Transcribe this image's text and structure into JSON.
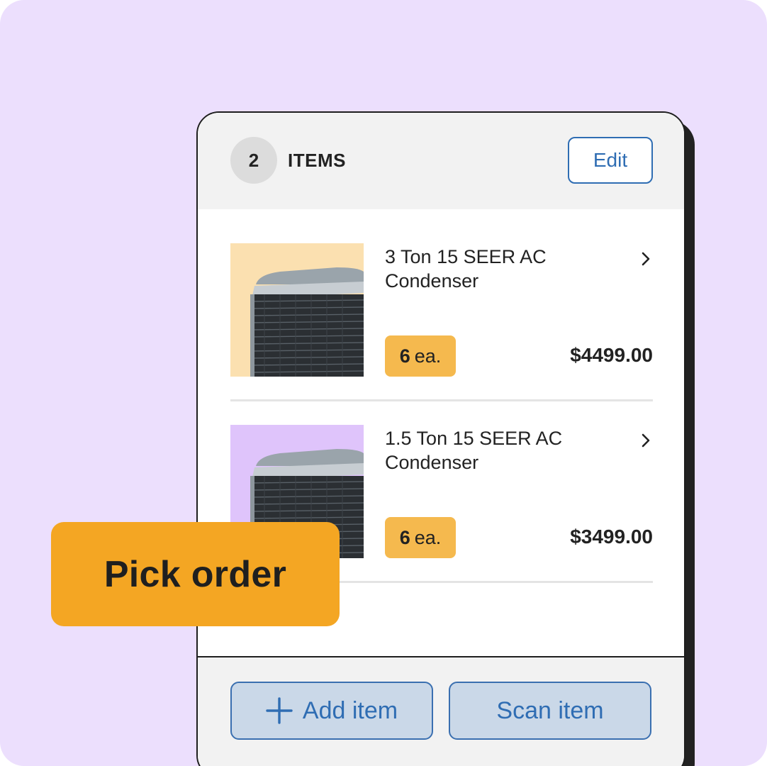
{
  "header": {
    "item_count": "2",
    "items_label": "ITEMS",
    "edit_label": "Edit"
  },
  "items": [
    {
      "title": "3 Ton 15 SEER AC Condenser",
      "qty_number": "6",
      "qty_unit": "ea.",
      "price": "$4499.00",
      "thumb_bg": "#fbe0b0",
      "icon": "chevron-right-icon"
    },
    {
      "title": "1.5 Ton 15 SEER AC Condenser",
      "qty_number": "6",
      "qty_unit": "ea.",
      "price": "$3499.00",
      "thumb_bg": "#dfc4fb",
      "icon": "chevron-right-icon"
    }
  ],
  "footer": {
    "add_label": "Add item",
    "scan_label": "Scan item"
  },
  "overlay": {
    "label": "Pick order"
  },
  "colors": {
    "page_bg": "#ecdffd",
    "accent_blue": "#2f6db3",
    "qty_badge": "#f5b94e",
    "pick_order_badge": "#f4a623"
  }
}
